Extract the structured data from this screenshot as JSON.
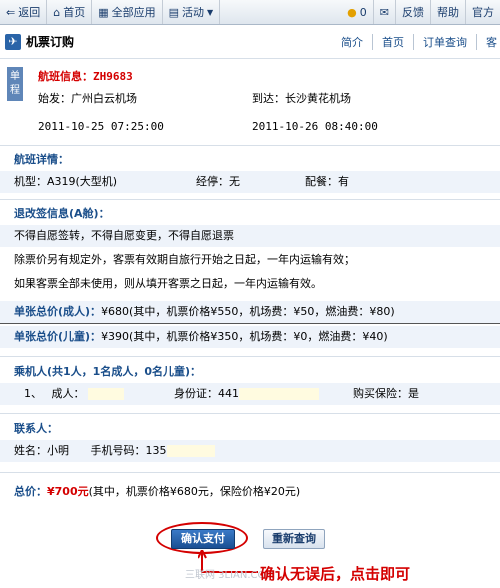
{
  "topbar": {
    "back": "返回",
    "home": "首页",
    "all_apps": "全部应用",
    "activity": "活动",
    "coins": "0",
    "feedback": "反馈",
    "help": "帮助",
    "official": "官方"
  },
  "header": {
    "title": "机票订购",
    "nav": [
      "简介",
      "首页",
      "订单查询",
      "客"
    ]
  },
  "flight": {
    "badge": "单程",
    "label": "航班信息：",
    "flight_no": "ZH9683",
    "depart_label": "始发：广州白云机场",
    "arrive_label": "到达：长沙黄花机场",
    "depart_time": "2011-10-25 07:25:00",
    "arrive_time": "2011-10-26 08:40:00"
  },
  "details": {
    "heading": "航班详情：",
    "aircraft": "机型：A319(大型机)",
    "stops": "经停：无",
    "meal": "配餐：有"
  },
  "refund": {
    "heading": "退改签信息(A舱)：",
    "lines": [
      "不得自愿签转，不得自愿变更，不得自愿退票",
      "除票价另有规定外，客票有效期自旅行开始之日起，一年内运输有效；",
      "如果客票全部未使用，则从填开客票之日起，一年内运输有效。"
    ]
  },
  "price_adult": {
    "label": "单张总价(成人)：",
    "text": "¥680(其中，机票价格¥550，机场费：¥50，燃油费：¥80)"
  },
  "price_child": {
    "label": "单张总价(儿童)：",
    "text": "¥390(其中，机票价格¥350，机场费：¥0，燃油费：¥40)"
  },
  "passengers": {
    "heading": "乘机人(共1人，1名成人，0名儿童)：",
    "index": "1、",
    "type": "成人：",
    "id_label": "身份证：441",
    "insurance": "购买保险：是"
  },
  "contact": {
    "heading": "联系人：",
    "name": "姓名：小明",
    "phone": "手机号码：135"
  },
  "total": {
    "label": "总价：",
    "amount": "¥700元",
    "detail": "(其中，机票价格¥680元，保险价格¥20元)"
  },
  "buttons": {
    "confirm": "确认支付",
    "requery": "重新查询"
  },
  "annotation": "确认无误后，点击即可",
  "watermark": "三联网 3LIAN.COM"
}
